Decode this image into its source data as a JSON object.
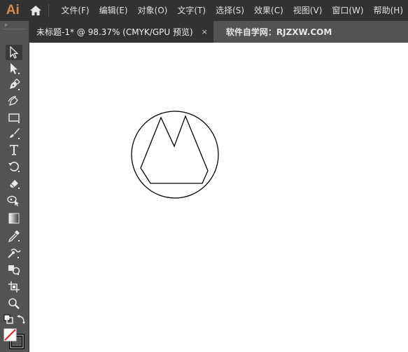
{
  "app": {
    "logo_text": "Ai",
    "accent": "#d98a4a"
  },
  "menu": {
    "items": [
      {
        "label": "文件(F)"
      },
      {
        "label": "编辑(E)"
      },
      {
        "label": "对象(O)"
      },
      {
        "label": "文字(T)"
      },
      {
        "label": "选择(S)"
      },
      {
        "label": "效果(C)"
      },
      {
        "label": "视图(V)"
      },
      {
        "label": "窗口(W)"
      },
      {
        "label": "帮助(H)"
      }
    ]
  },
  "tabs": {
    "active_label": "未标题-1* @ 98.37% (CMYK/GPU 预览)",
    "close_glyph": "×",
    "inactive_label": "软件自学网：RJZXW.COM"
  },
  "toolbar": {
    "grip": "»",
    "tools": [
      "selection-tool-icon",
      "direct-selection-tool-icon",
      "pen-tool-icon",
      "curvature-tool-icon",
      "rectangle-tool-icon",
      "paintbrush-tool-icon",
      "type-tool-icon",
      "rotate-tool-icon",
      "eraser-tool-icon",
      "shape-builder-tool-icon",
      "gradient-tool-icon",
      "eyedropper-tool-icon",
      "blend-tool-icon",
      "symbol-sprayer-tool-icon",
      "artboard-tool-icon",
      "zoom-tool-icon"
    ]
  },
  "artwork": {
    "shapes": [
      "circle",
      "mountain-polygon"
    ],
    "stroke_color": "#000000"
  }
}
